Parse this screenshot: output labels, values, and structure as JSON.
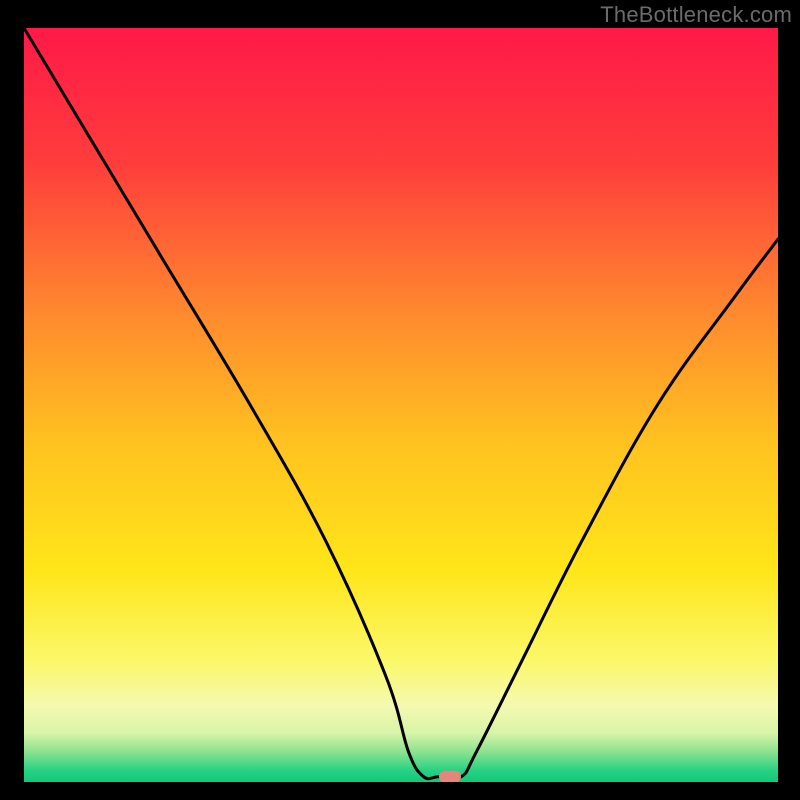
{
  "watermark": "TheBottleneck.com",
  "chart_data": {
    "type": "line",
    "title": "",
    "xlabel": "",
    "ylabel": "",
    "xlim": [
      0,
      100
    ],
    "ylim": [
      0,
      100
    ],
    "legend": false,
    "grid": false,
    "series": [
      {
        "name": "bottleneck-curve",
        "x": [
          0,
          6,
          18,
          30,
          40,
          48,
          51,
          53,
          55,
          58,
          60,
          66,
          74,
          84,
          94,
          100
        ],
        "values": [
          100,
          90,
          70,
          50,
          32,
          14,
          4,
          0.7,
          0.7,
          0.7,
          4,
          16,
          32,
          50,
          64,
          72
        ]
      }
    ],
    "marker": {
      "x": 56.5,
      "y": 0.7,
      "color": "#e6857c"
    },
    "background_gradient": {
      "stops": [
        {
          "offset": 0.0,
          "color": "#ff1948"
        },
        {
          "offset": 0.18,
          "color": "#ff3d3c"
        },
        {
          "offset": 0.38,
          "color": "#ff8a2e"
        },
        {
          "offset": 0.55,
          "color": "#ffc220"
        },
        {
          "offset": 0.72,
          "color": "#ffe61a"
        },
        {
          "offset": 0.84,
          "color": "#fbf86a"
        },
        {
          "offset": 0.9,
          "color": "#f4f9b0"
        },
        {
          "offset": 0.935,
          "color": "#d8f4a8"
        },
        {
          "offset": 0.96,
          "color": "#8be28f"
        },
        {
          "offset": 0.985,
          "color": "#27d183"
        },
        {
          "offset": 1.0,
          "color": "#0fc979"
        }
      ]
    }
  }
}
